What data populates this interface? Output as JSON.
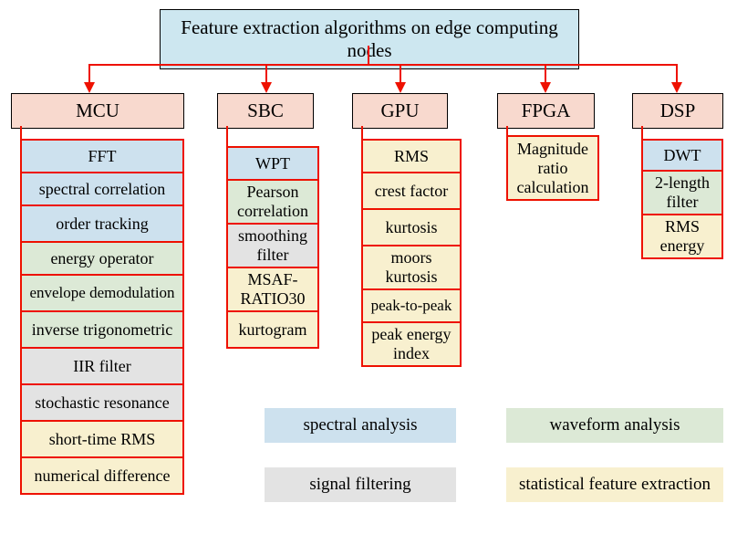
{
  "title": "Feature extraction algorithms on edge computing nodes",
  "categories": {
    "mcu": {
      "label": "MCU"
    },
    "sbc": {
      "label": "SBC"
    },
    "gpu": {
      "label": "GPU"
    },
    "fpga": {
      "label": "FPGA"
    },
    "dsp": {
      "label": "DSP"
    }
  },
  "mcu": {
    "fft": "FFT",
    "spectral_correlation": "spectral correlation",
    "order_tracking": "order tracking",
    "energy_operator": "energy operator",
    "envelope_demod": "envelope demodulation",
    "inverse_trig": "inverse trigonometric",
    "iir": "IIR filter",
    "stochastic": "stochastic resonance",
    "short_rms": "short-time RMS",
    "num_diff": "numerical difference"
  },
  "sbc": {
    "wpt": "WPT",
    "pearson": "Pearson correlation",
    "smoothing": "smoothing filter",
    "msaf": "MSAF-RATIO30",
    "kurtogram": "kurtogram"
  },
  "gpu": {
    "rms": "RMS",
    "crest": "crest factor",
    "kurtosis": "kurtosis",
    "moors": "moors kurtosis",
    "p2p": "peak-to-peak",
    "pei": "peak energy index"
  },
  "fpga": {
    "mag_ratio": "Magnitude ratio calculation"
  },
  "dsp": {
    "dwt": "DWT",
    "two_len": "2-length filter",
    "rms_energy": "RMS energy"
  },
  "legend": {
    "spectral": "spectral analysis",
    "waveform": "waveform analysis",
    "signal": "signal filtering",
    "stat": "statistical feature extraction"
  }
}
